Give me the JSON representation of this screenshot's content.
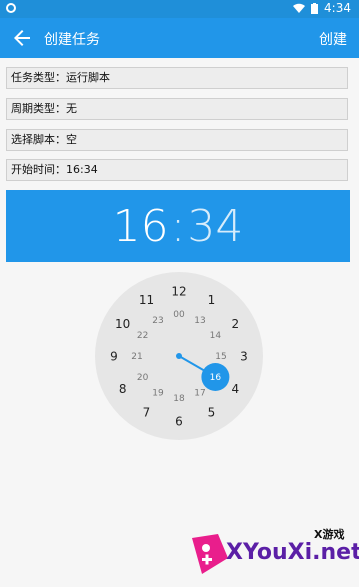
{
  "status_bar": {
    "time": "4:34"
  },
  "app_bar": {
    "title": "创建任务",
    "action_label": "创建"
  },
  "fields": [
    {
      "label": "任务类型：",
      "value": "运行脚本"
    },
    {
      "label": "周期类型：",
      "value": "无"
    },
    {
      "label": "选择脚本：",
      "value": "空"
    },
    {
      "label": "开始时间：",
      "value": "16:34"
    }
  ],
  "time_picker": {
    "hour": "16",
    "separator": ":",
    "minute": "34",
    "outer_hours": [
      "12",
      "1",
      "2",
      "3",
      "4",
      "5",
      "6",
      "7",
      "8",
      "9",
      "10",
      "11"
    ],
    "inner_hours": [
      "00",
      "13",
      "14",
      "15",
      "16",
      "17",
      "18",
      "19",
      "20",
      "21",
      "22",
      "23"
    ],
    "selected_hour": "16",
    "accent_color": "#2196e9"
  },
  "watermark": {
    "logo": "XYouXi.net",
    "brand": "X游戏"
  }
}
